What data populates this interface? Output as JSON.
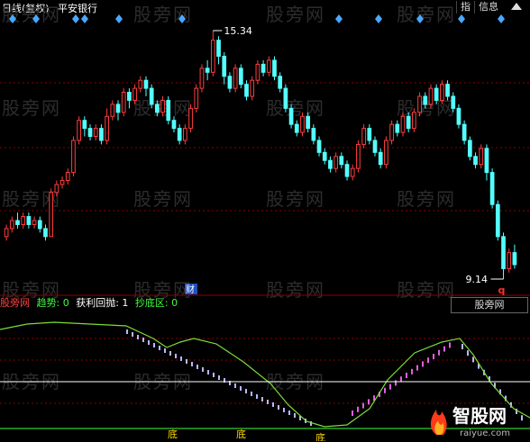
{
  "header": {
    "period": "日线(复权)",
    "stock_name": "平安银行",
    "btn_index": "指",
    "btn_info": "信息"
  },
  "watermark": "股旁网",
  "price_chart": {
    "high_label": "15.34",
    "low_label": "9.14",
    "cai_marker": "财",
    "q_marker": "q",
    "colors": {
      "up": "#ff3d3d",
      "down": "#54ffff",
      "grid": "#8b0000"
    }
  },
  "indicator": {
    "legend_name": "股旁网",
    "trend_label": "趋势: 0",
    "profit_label": "获利回抛: 1",
    "bottom_label": "抄底区: 0",
    "button_label": "股旁网",
    "bottom_markers": [
      "底",
      "底",
      "底"
    ],
    "colors": {
      "legend_name": "#ff4040",
      "trend": "#40ff40",
      "profit": "#ffffff",
      "bottom": "#40ff40",
      "line": "#7ddc3a"
    }
  },
  "brand": {
    "name": "智股网",
    "domain": "raiyue.com"
  },
  "chart_data": {
    "type": "candlestick",
    "title": "平安银行 日线(复权)",
    "ymax_label": 15.34,
    "ymin_label": 9.14,
    "candles": [
      [
        10.2,
        10.4,
        10.1,
        10.5
      ],
      [
        10.4,
        10.6,
        10.3,
        10.7
      ],
      [
        10.6,
        10.5,
        10.4,
        10.8
      ],
      [
        10.5,
        10.7,
        10.4,
        10.8
      ],
      [
        10.7,
        10.5,
        10.4,
        10.8
      ],
      [
        10.5,
        10.6,
        10.4,
        10.7
      ],
      [
        10.6,
        10.4,
        10.3,
        10.7
      ],
      [
        10.4,
        10.2,
        10.1,
        10.5
      ],
      [
        10.2,
        11.3,
        10.2,
        11.4
      ],
      [
        11.3,
        11.5,
        11.2,
        11.6
      ],
      [
        11.5,
        11.6,
        11.4,
        11.7
      ],
      [
        11.6,
        11.8,
        11.5,
        11.9
      ],
      [
        11.8,
        12.6,
        11.7,
        12.7
      ],
      [
        12.6,
        13.1,
        12.5,
        13.2
      ],
      [
        13.1,
        12.9,
        12.7,
        13.2
      ],
      [
        12.9,
        12.7,
        12.6,
        13.0
      ],
      [
        12.7,
        12.9,
        12.6,
        13.0
      ],
      [
        12.9,
        12.6,
        12.5,
        13.0
      ],
      [
        12.6,
        13.2,
        12.5,
        13.4
      ],
      [
        13.2,
        13.5,
        13.1,
        13.6
      ],
      [
        13.5,
        13.3,
        13.1,
        13.6
      ],
      [
        13.3,
        13.8,
        13.2,
        13.9
      ],
      [
        13.8,
        13.6,
        13.4,
        13.9
      ],
      [
        13.6,
        13.9,
        13.5,
        14.0
      ],
      [
        13.9,
        14.1,
        13.8,
        14.2
      ],
      [
        14.1,
        13.9,
        13.7,
        14.2
      ],
      [
        13.9,
        13.5,
        13.4,
        14.0
      ],
      [
        13.5,
        13.3,
        13.2,
        13.6
      ],
      [
        13.3,
        13.6,
        13.2,
        13.7
      ],
      [
        13.6,
        13.1,
        13.0,
        13.7
      ],
      [
        13.1,
        12.9,
        12.8,
        13.2
      ],
      [
        12.9,
        12.6,
        12.5,
        13.0
      ],
      [
        12.6,
        12.9,
        12.5,
        13.0
      ],
      [
        12.9,
        13.4,
        12.8,
        13.5
      ],
      [
        13.4,
        13.9,
        13.3,
        14.0
      ],
      [
        13.9,
        14.4,
        13.8,
        14.5
      ],
      [
        14.4,
        14.3,
        14.1,
        14.6
      ],
      [
        14.3,
        15.1,
        14.2,
        15.34
      ],
      [
        15.1,
        14.7,
        14.5,
        15.2
      ],
      [
        14.7,
        14.2,
        14.0,
        14.8
      ],
      [
        14.2,
        13.9,
        13.8,
        14.3
      ],
      [
        13.9,
        14.4,
        13.8,
        14.5
      ],
      [
        14.4,
        14.0,
        13.9,
        14.5
      ],
      [
        14.0,
        13.7,
        13.6,
        14.1
      ],
      [
        13.7,
        14.1,
        13.6,
        14.2
      ],
      [
        14.1,
        14.5,
        14.0,
        14.6
      ],
      [
        14.5,
        14.3,
        14.2,
        14.6
      ],
      [
        14.3,
        14.6,
        14.2,
        14.7
      ],
      [
        14.6,
        14.2,
        14.1,
        14.7
      ],
      [
        14.2,
        13.9,
        13.8,
        14.3
      ],
      [
        13.9,
        13.4,
        13.3,
        14.0
      ],
      [
        13.4,
        13.0,
        12.9,
        13.5
      ],
      [
        13.0,
        12.8,
        12.7,
        13.1
      ],
      [
        12.8,
        13.2,
        12.7,
        13.3
      ],
      [
        13.2,
        12.9,
        12.8,
        13.3
      ],
      [
        12.9,
        12.6,
        12.5,
        13.0
      ],
      [
        12.6,
        12.3,
        12.2,
        12.7
      ],
      [
        12.3,
        12.1,
        12.0,
        12.4
      ],
      [
        12.1,
        11.9,
        11.8,
        12.2
      ],
      [
        11.9,
        12.2,
        11.8,
        12.3
      ],
      [
        12.2,
        12.0,
        11.9,
        12.3
      ],
      [
        12.0,
        11.7,
        11.6,
        12.1
      ],
      [
        11.7,
        11.9,
        11.6,
        12.0
      ],
      [
        11.9,
        12.5,
        11.8,
        12.6
      ],
      [
        12.5,
        12.9,
        12.4,
        13.0
      ],
      [
        12.9,
        12.6,
        12.5,
        13.0
      ],
      [
        12.6,
        12.3,
        12.2,
        12.7
      ],
      [
        12.3,
        12.0,
        11.9,
        12.4
      ],
      [
        12.0,
        12.6,
        11.9,
        12.7
      ],
      [
        12.6,
        13.0,
        12.5,
        13.1
      ],
      [
        13.0,
        12.8,
        12.7,
        13.1
      ],
      [
        12.8,
        13.2,
        12.7,
        13.3
      ],
      [
        13.2,
        12.9,
        12.8,
        13.3
      ],
      [
        12.9,
        13.3,
        12.8,
        13.4
      ],
      [
        13.3,
        13.7,
        13.2,
        13.8
      ],
      [
        13.7,
        13.5,
        13.4,
        13.8
      ],
      [
        13.5,
        13.9,
        13.4,
        14.0
      ],
      [
        13.9,
        13.6,
        13.5,
        14.0
      ],
      [
        13.6,
        14.0,
        13.5,
        14.1
      ],
      [
        14.0,
        13.7,
        13.6,
        14.1
      ],
      [
        13.7,
        13.4,
        13.3,
        13.8
      ],
      [
        13.4,
        13.0,
        12.9,
        13.5
      ],
      [
        13.0,
        12.6,
        12.5,
        13.1
      ],
      [
        12.6,
        12.2,
        12.1,
        12.7
      ],
      [
        12.2,
        12.0,
        11.9,
        12.3
      ],
      [
        12.0,
        12.4,
        11.9,
        12.5
      ],
      [
        12.4,
        11.8,
        11.6,
        12.5
      ],
      [
        11.8,
        11.0,
        10.9,
        11.9
      ],
      [
        11.0,
        10.2,
        10.1,
        11.1
      ],
      [
        10.2,
        9.4,
        9.14,
        10.3
      ],
      [
        9.4,
        9.8,
        9.3,
        9.9
      ],
      [
        9.8,
        9.5,
        9.4,
        10.0
      ]
    ]
  }
}
